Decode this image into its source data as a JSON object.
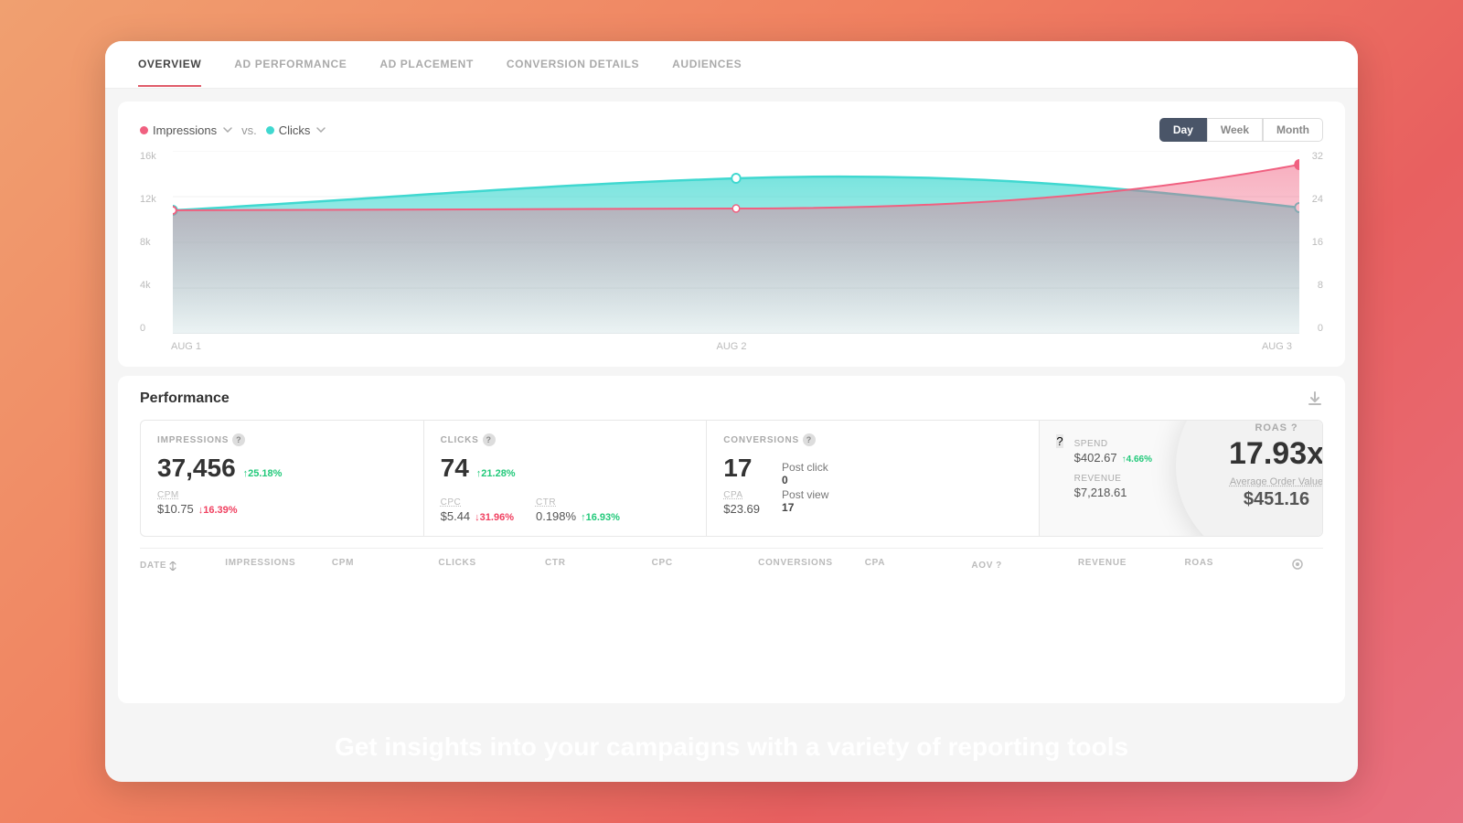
{
  "nav": {
    "items": [
      {
        "label": "OVERVIEW",
        "active": true
      },
      {
        "label": "AD PERFORMANCE",
        "active": false
      },
      {
        "label": "AD PLACEMENT",
        "active": false
      },
      {
        "label": "CONVERSION DETAILS",
        "active": false
      },
      {
        "label": "AUDIENCES",
        "active": false
      }
    ]
  },
  "chart": {
    "legend": {
      "impressions_label": "Impressions",
      "vs_label": "vs.",
      "clicks_label": "Clicks"
    },
    "time_buttons": [
      {
        "label": "Day",
        "active": true
      },
      {
        "label": "Week",
        "active": false
      },
      {
        "label": "Month",
        "active": false
      }
    ],
    "y_axis_left": [
      "16k",
      "12k",
      "8k",
      "4k",
      "0"
    ],
    "y_axis_right": [
      "32",
      "24",
      "16",
      "8",
      "0"
    ],
    "x_axis": [
      "AUG 1",
      "AUG 2",
      "AUG 3"
    ]
  },
  "performance": {
    "title": "Performance",
    "metrics": {
      "impressions": {
        "label": "IMPRESSIONS",
        "value": "37,456",
        "change": "↑25.18%",
        "change_dir": "up",
        "sub_label": "CPM",
        "sub_value": "$10.75",
        "sub_change": "↓16.39%",
        "sub_change_dir": "down"
      },
      "clicks": {
        "label": "CLICKS",
        "value": "74",
        "change": "↑21.28%",
        "change_dir": "up",
        "sub_label": "CPC",
        "sub_value": "$5.44",
        "sub_change": "↓31.96%",
        "sub_change_dir": "down",
        "sub2_label": "CTR",
        "sub2_value": "0.198%",
        "sub2_change": "↑16.93%",
        "sub2_change_dir": "up"
      },
      "conversions": {
        "label": "CONVERSIONS",
        "value": "17",
        "sub_label": "CPA",
        "sub_value": "$23.69",
        "post_click_label": "Post click",
        "post_click_value": "0",
        "post_view_label": "Post view",
        "post_view_value": "17"
      },
      "roas": {
        "label": "ROAS",
        "value": "17.93x",
        "aov_label": "Average Order Value",
        "aov_value": "$451.16",
        "spend_label": "Spend",
        "spend_value": "$402.67",
        "spend_change": "↑4.66%",
        "spend_change_dir": "up",
        "revenue_label": "Revenue",
        "revenue_value": "$7,218.61"
      }
    }
  },
  "table_headers": [
    "DATE",
    "IMPRESSIONS",
    "CPM",
    "CLICKS",
    "CTR",
    "CPC",
    "CONVERSIONS",
    "CPA",
    "AOV",
    "",
    "REVENUE",
    "ROAS",
    ""
  ],
  "bottom_banner": {
    "text": "Get insights into your campaigns with a variety of reporting tools"
  }
}
